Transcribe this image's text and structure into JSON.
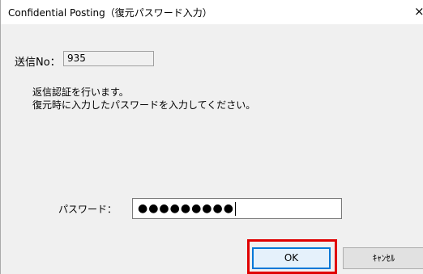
{
  "window": {
    "title": "Confidential Posting（復元パスワード入力）",
    "close_glyph": "×"
  },
  "send": {
    "label": "送信No：",
    "value": "935"
  },
  "message": {
    "line1": "返信認証を行います。",
    "line2": "復元時に入力したパスワードを入力してください。"
  },
  "password": {
    "label": "パスワード：",
    "masked_value": "●●●●●●●●●"
  },
  "buttons": {
    "ok_label": "OK",
    "cancel_label": "ｷｬﾝｾﾙ"
  },
  "colors": {
    "highlight": "#e00000",
    "focus_border": "#0078d7",
    "dialog_bg": "#f0f0f0"
  }
}
